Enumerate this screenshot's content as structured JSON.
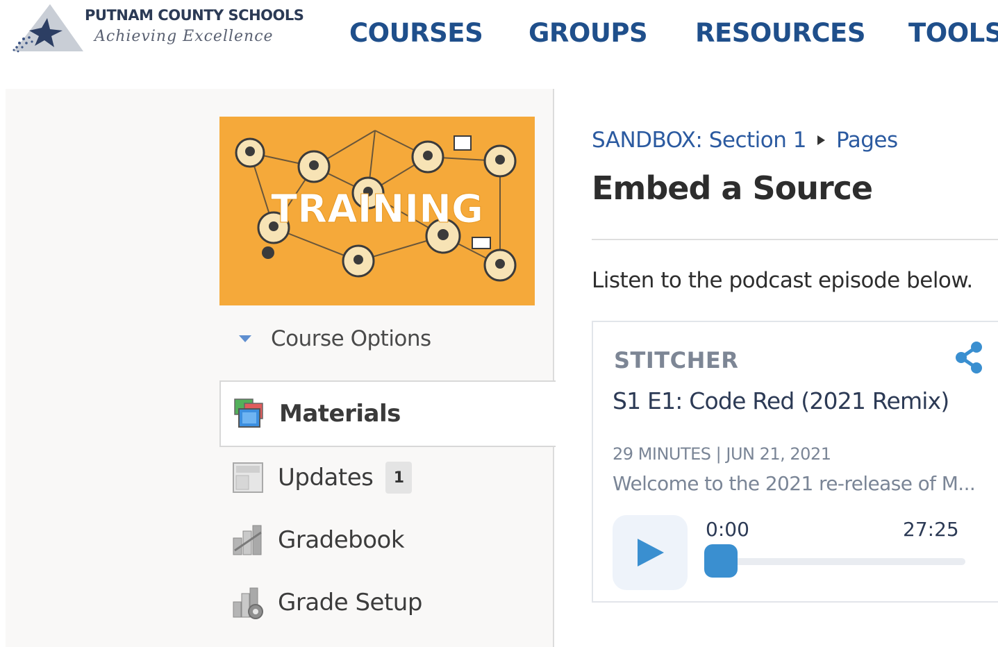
{
  "header": {
    "logo": {
      "name": "PUTNAM COUNTY SCHOOLS",
      "tagline": "Achieving Excellence"
    },
    "nav": [
      {
        "label": "COURSES"
      },
      {
        "label": "GROUPS"
      },
      {
        "label": "RESOURCES"
      },
      {
        "label": "TOOLS"
      }
    ]
  },
  "sidebar": {
    "course_image_text": "TRAINING",
    "course_options_label": "Course Options",
    "items": [
      {
        "label": "Materials",
        "active": true
      },
      {
        "label": "Updates",
        "badge": "1"
      },
      {
        "label": "Gradebook"
      },
      {
        "label": "Grade Setup"
      }
    ]
  },
  "main": {
    "breadcrumb": [
      "SANDBOX: Section 1",
      "Pages"
    ],
    "title": "Embed a Source",
    "intro": "Listen to the podcast episode below.",
    "player": {
      "brand": "STITCHER",
      "episode_title": "S1 E1: Code Red (2021 Remix)",
      "meta": "29 MINUTES | JUN 21, 2021",
      "description": "Welcome to the 2021 re-release of M...",
      "current_time": "0:00",
      "total_time": "27:25",
      "progress": 0
    }
  },
  "colors": {
    "nav": "#1f4f8b",
    "link": "#2b5aa0",
    "course_image_bg": "#f5a93a",
    "player_accent": "#3a8fd0"
  },
  "icons": [
    "logo-star-icon",
    "materials-icon",
    "updates-icon",
    "gradebook-icon",
    "grade-setup-icon",
    "share-icon",
    "play-icon"
  ]
}
